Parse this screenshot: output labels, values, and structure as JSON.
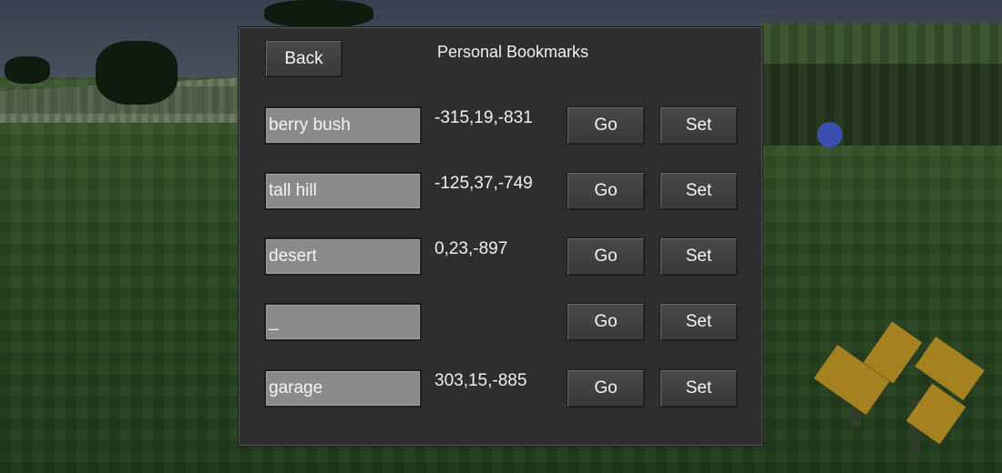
{
  "panel": {
    "title": "Personal Bookmarks",
    "back_label": "Back"
  },
  "bookmarks": [
    {
      "name": "berry bush",
      "coords": "-315,19,-831",
      "go_label": "Go",
      "set_label": "Set"
    },
    {
      "name": "tall hill",
      "coords": "-125,37,-749",
      "go_label": "Go",
      "set_label": "Set"
    },
    {
      "name": "desert",
      "coords": "0,23,-897",
      "go_label": "Go",
      "set_label": "Set"
    },
    {
      "name": "_",
      "coords": "",
      "go_label": "Go",
      "set_label": "Set"
    },
    {
      "name": "garage",
      "coords": "303,15,-885",
      "go_label": "Go",
      "set_label": "Set"
    }
  ],
  "colors": {
    "panel_bg": "#2e2e2e",
    "button_bg": "#404040",
    "field_bg": "#8a8a8a",
    "text": "#f0f0f0"
  }
}
